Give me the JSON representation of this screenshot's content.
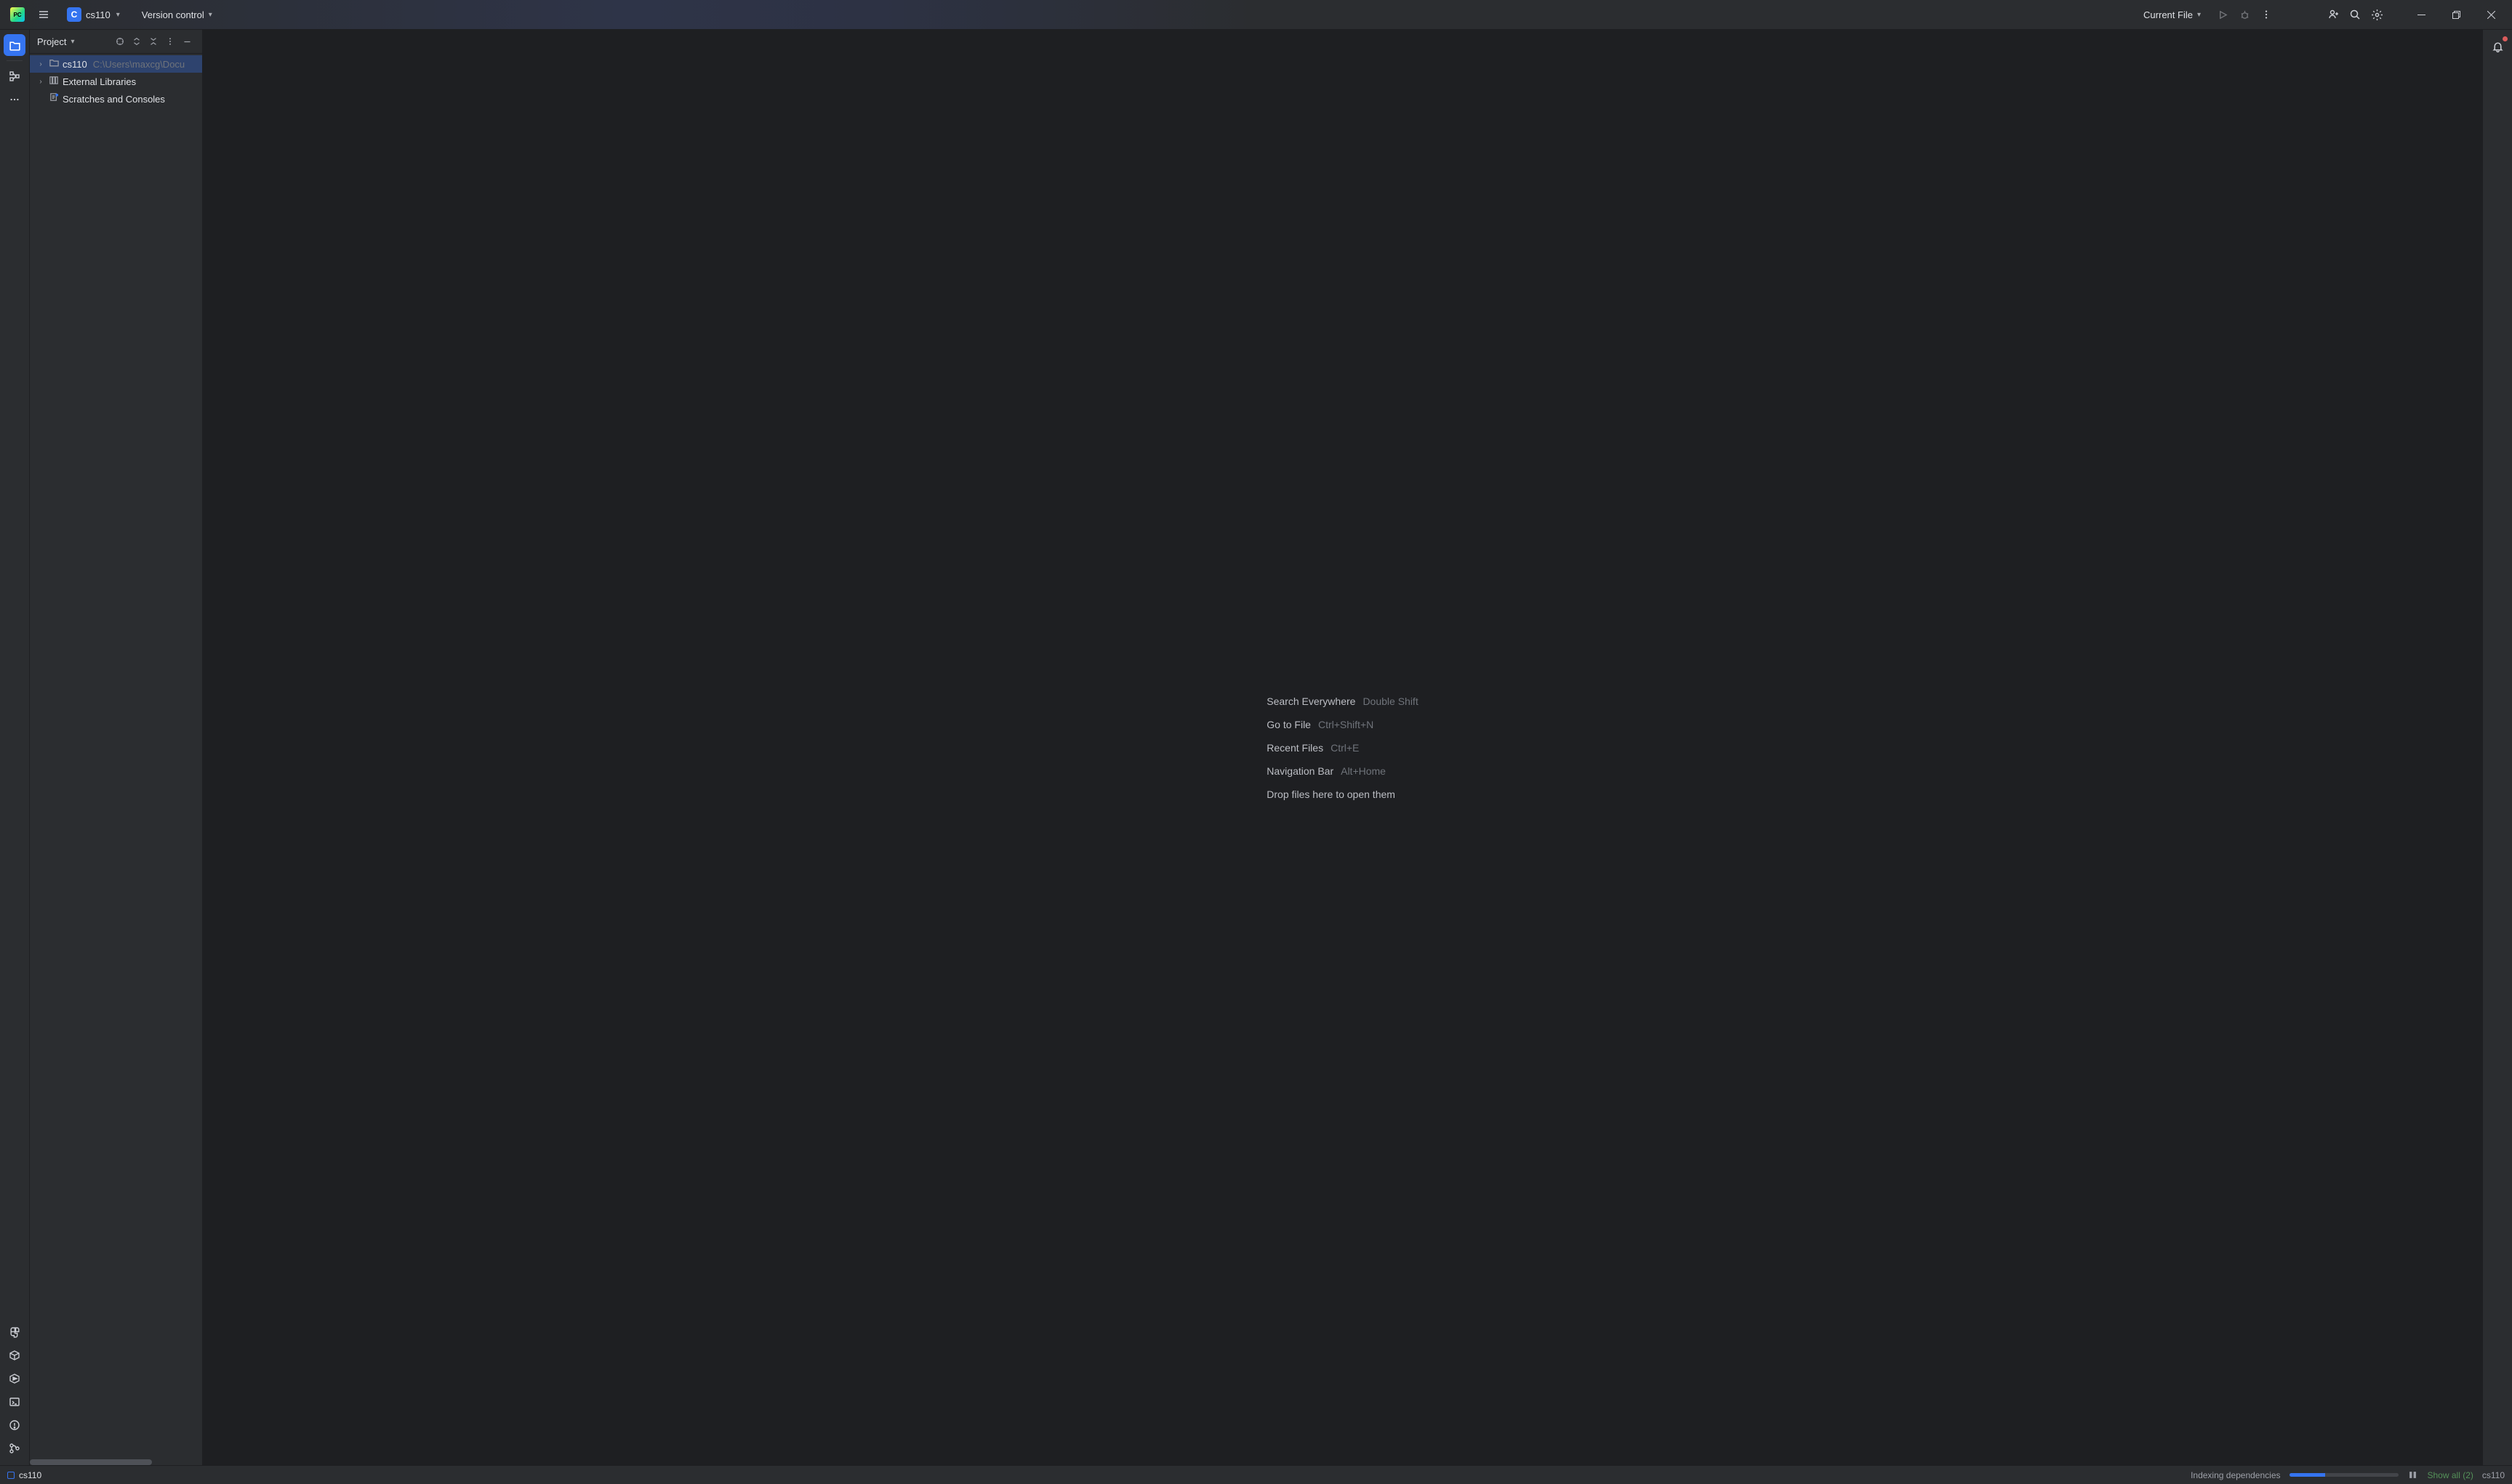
{
  "project": {
    "badge": "C",
    "name": "cs110"
  },
  "menu": {
    "version_control": "Version control"
  },
  "run": {
    "config": "Current File"
  },
  "panel": {
    "title": "Project"
  },
  "tree": {
    "root": {
      "name": "cs110",
      "path": "C:\\Users\\maxcg\\Docu"
    },
    "external": "External Libraries",
    "scratches": "Scratches and Consoles"
  },
  "editor_hints": [
    {
      "action": "Search Everywhere",
      "key": "Double Shift"
    },
    {
      "action": "Go to File",
      "key": "Ctrl+Shift+N"
    },
    {
      "action": "Recent Files",
      "key": "Ctrl+E"
    },
    {
      "action": "Navigation Bar",
      "key": "Alt+Home"
    }
  ],
  "editor_drop_hint": "Drop files here to open them",
  "status": {
    "breadcrumb": "cs110",
    "task": "Indexing dependencies",
    "progress_pct": 33,
    "show_all": "Show all (2)",
    "interpreter": "cs110"
  }
}
